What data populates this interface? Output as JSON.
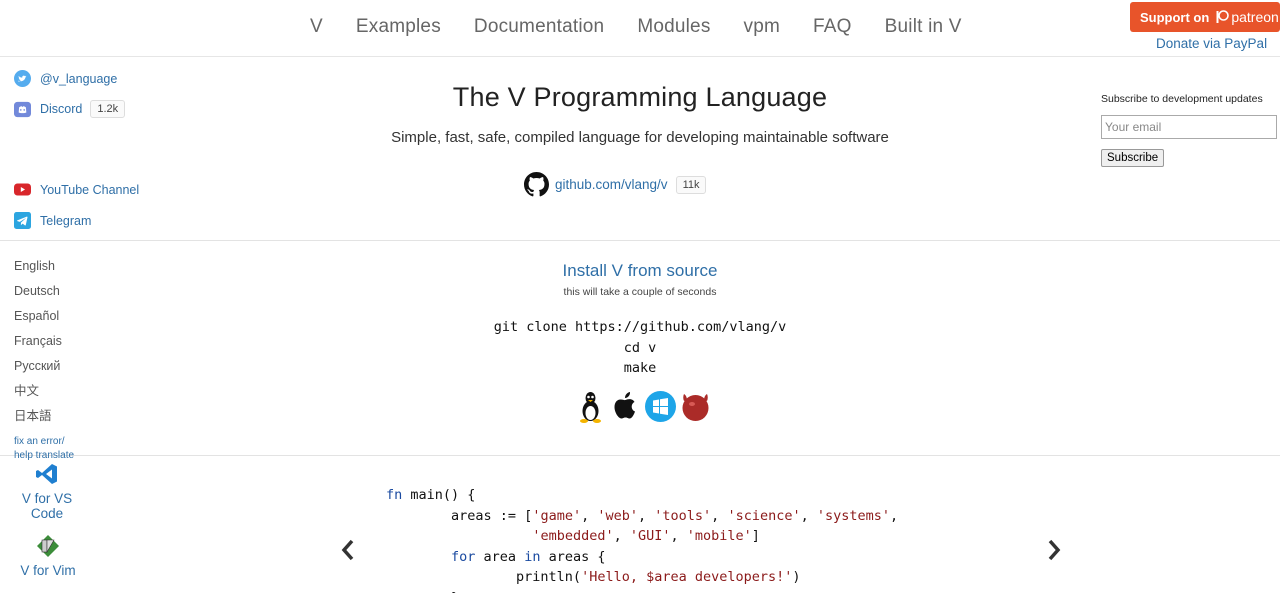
{
  "nav": {
    "items": [
      "V",
      "Examples",
      "Documentation",
      "Modules",
      "vpm",
      "FAQ",
      "Built in V"
    ],
    "patreon_label": "Support on",
    "patreon_brand": "patreon",
    "paypal_label": "Donate via PayPal"
  },
  "social": {
    "twitter": "@v_language",
    "discord": "Discord",
    "discord_count": "1.2k",
    "youtube": "YouTube Channel",
    "telegram": "Telegram"
  },
  "languages": [
    "English",
    "Deutsch",
    "Español",
    "Français",
    "Русский",
    "中文",
    "日本語"
  ],
  "fix_error": [
    "fix an error/",
    "help translate"
  ],
  "editors": {
    "vscode": "V for VS Code",
    "vim": "V for Vim"
  },
  "hero": {
    "title": "The V Programming Language",
    "subtitle": "Simple, fast, safe, compiled language for developing maintainable software",
    "github_link": "github.com/vlang/v",
    "github_stars": "11k"
  },
  "install": {
    "title": "Install V from source",
    "subtitle": "this will take a couple of seconds",
    "commands": [
      "git clone https://github.com/vlang/v",
      "cd v",
      "make"
    ],
    "os_icons": [
      "linux-icon",
      "apple-icon",
      "windows-icon",
      "freebsd-icon"
    ]
  },
  "subscribe": {
    "label": "Subscribe to development updates",
    "placeholder": "Your email",
    "button": "Subscribe"
  },
  "code_sample": {
    "lines": [
      "fn main() {",
      "        areas := ['game', 'web', 'tools', 'science', 'systems',",
      "                  'embedded', 'GUI', 'mobile']",
      "        for area in areas {",
      "                println('Hello, $area developers!')",
      "        }"
    ]
  },
  "colors": {
    "link": "#2f6fa7",
    "patreon": "#e8542a",
    "keyword": "#1a4aa0",
    "string": "#8b1a1a"
  }
}
